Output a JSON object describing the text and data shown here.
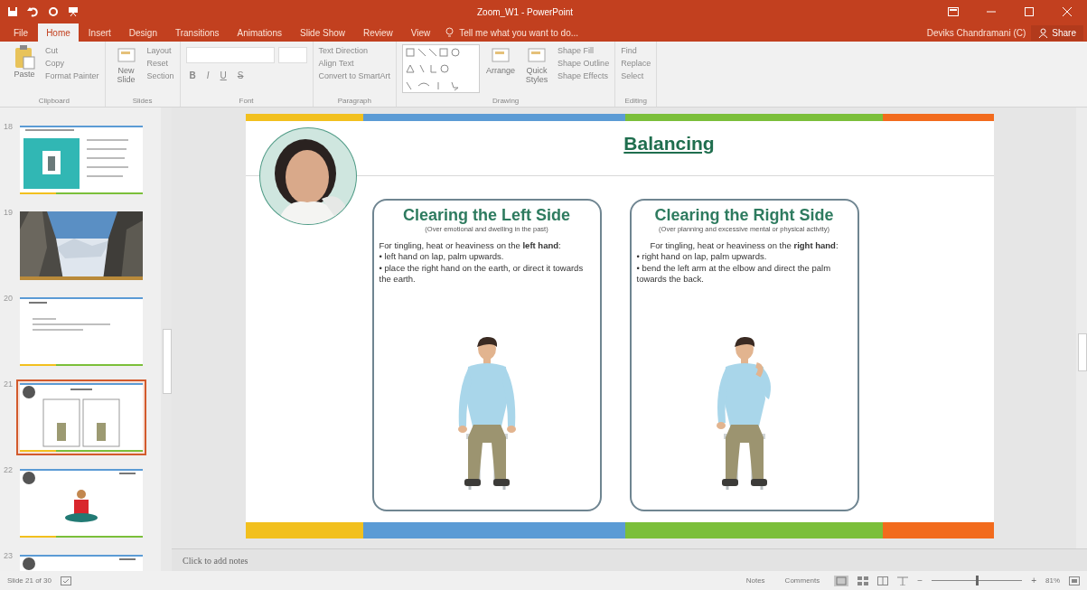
{
  "window": {
    "title": "Zoom_W1 - PowerPoint",
    "user": "Deviks Chandramani (C)",
    "share": "Share"
  },
  "tabs": [
    {
      "label": "File",
      "selected": false
    },
    {
      "label": "Home",
      "selected": true
    },
    {
      "label": "Insert",
      "selected": false
    },
    {
      "label": "Design",
      "selected": false
    },
    {
      "label": "Transitions",
      "selected": false
    },
    {
      "label": "Animations",
      "selected": false
    },
    {
      "label": "Slide Show",
      "selected": false
    },
    {
      "label": "Review",
      "selected": false
    },
    {
      "label": "View",
      "selected": false
    }
  ],
  "tell_me": {
    "placeholder": "Tell me what you want to do..."
  },
  "ribbon": [
    {
      "kind": "commands",
      "label": "Clipboard",
      "large": [
        "Paste"
      ],
      "small": [
        "Cut",
        "Copy",
        "Format Painter"
      ]
    },
    {
      "kind": "commands",
      "label": "Slides",
      "large": [
        "New Slide"
      ],
      "small": [
        "Layout",
        "Reset",
        "Section"
      ]
    },
    {
      "kind": "font",
      "label": "Font",
      "keys": [
        "B",
        "I",
        "U",
        "S"
      ]
    },
    {
      "kind": "commands",
      "label": "Paragraph",
      "small": [
        "Text Direction",
        "Align Text",
        "Convert to SmartArt"
      ]
    },
    {
      "kind": "drawing",
      "label": "Drawing",
      "large": [
        "Arrange",
        "Quick Styles"
      ],
      "small": [
        "Shape Fill",
        "Shape Outline",
        "Shape Effects"
      ]
    },
    {
      "kind": "commands",
      "label": "Editing",
      "small": [
        "Find",
        "Replace",
        "Select"
      ]
    }
  ],
  "thumbnails": [
    {
      "number": "18",
      "kind": "grid",
      "selected": false
    },
    {
      "number": "19",
      "kind": "picture",
      "selected": false
    },
    {
      "number": "20",
      "kind": "text",
      "selected": false
    },
    {
      "number": "21",
      "kind": "cards",
      "selected": true
    },
    {
      "number": "22",
      "kind": "figure",
      "selected": false
    },
    {
      "number": "23",
      "kind": "partial",
      "selected": false
    }
  ],
  "slide": {
    "title": "Balancing",
    "cards": [
      {
        "title": "Clearing the Left Side",
        "subtitle": "(Over emotional and dwelling in the past)",
        "intro": "For tingling, heat or heaviness on the **left hand**:",
        "bullets": [
          "• left hand on lap, palm upwards.",
          "• place the right hand on the earth, or direct it towards the earth."
        ]
      },
      {
        "title": "Clearing the Right Side",
        "subtitle": "(Over planning and excessive mental or physical activity)",
        "intro": "For tingling, heat or heaviness on the **right hand**:",
        "bullets": [
          "• right hand on lap, palm upwards.",
          "• bend the left arm at the elbow and direct the palm towards the back."
        ]
      }
    ]
  },
  "notes": {
    "placeholder": "Click to add notes"
  },
  "status_bar": {
    "slide": "Slide 21 of 30",
    "notes": "Notes",
    "comments": "Comments",
    "zoom": {
      "out": "−",
      "level": 0.5,
      "in": "+",
      "reading": "81%"
    }
  }
}
